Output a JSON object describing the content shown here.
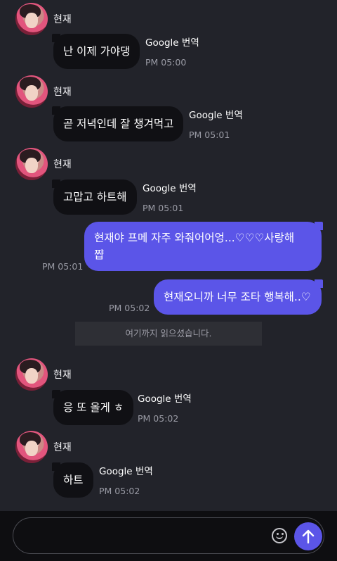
{
  "messages": [
    {
      "sender": "현재",
      "text": "난 이제 가야댕",
      "translate": "Google 번역",
      "time": "PM 05:00"
    },
    {
      "sender": "현재",
      "text": "곧 저녁인데 잘 챙겨먹고",
      "translate": "Google 번역",
      "time": "PM 05:01"
    },
    {
      "sender": "현재",
      "text": "고맙고 하트해",
      "translate": "Google 번역",
      "time": "PM 05:01"
    },
    {
      "sender": "현재",
      "text": "응 또 올게 ㅎ",
      "translate": "Google 번역",
      "time": "PM 05:02"
    },
    {
      "sender": "현재",
      "text": "하트",
      "translate": "Google 번역",
      "time": "PM 05:02"
    }
  ],
  "sent": [
    {
      "line1": "현재야 프메 자주 와줘어어엉...♡♡♡사랑해",
      "line2": "쨥",
      "time": "PM 05:01"
    },
    {
      "text": "현재오니까 너무 조타 행복해..♡",
      "time": "PM 05:02"
    }
  ],
  "read_notice": "여기까지 읽으셨습니다.",
  "composer": {
    "placeholder": "",
    "send_icon": "arrow-up-icon",
    "emoji_icon": "smile-icon"
  },
  "colors": {
    "background": "#22232a",
    "incoming_bubble": "#101014",
    "outgoing_bubble": "#5b55e8"
  }
}
